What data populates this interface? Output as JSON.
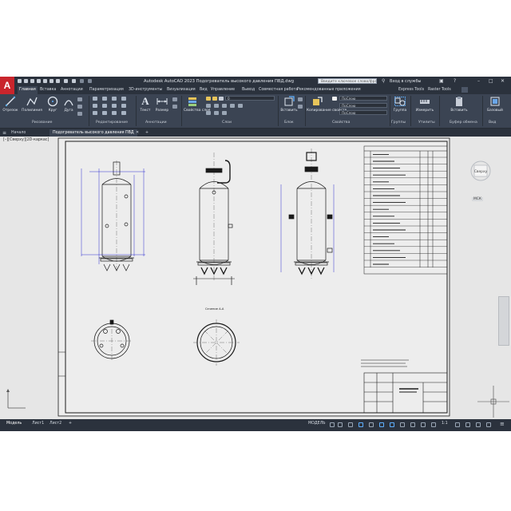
{
  "window": {
    "logo": "A",
    "title": "Autodesk AutoCAD 2023   Подогреватель высокого давления ПВД.dwg",
    "search_placeholder": "Введите ключевое слово/фразу",
    "sign_in": "Вход в службы",
    "controls": [
      "–",
      "□",
      "✕"
    ]
  },
  "menu_tabs": [
    "Главная",
    "Вставка",
    "Аннотации",
    "Параметризация",
    "3D-инструменты",
    "Визуализация",
    "Вид",
    "Управление",
    "Вывод",
    "Совместная работа",
    "Рекомендованные приложения",
    "Express Tools",
    "Raster Tools"
  ],
  "ribbon": {
    "tools": {
      "line": "Отрезок",
      "polyline": "Полилиния",
      "circle": "Круг",
      "arc": "Дуга",
      "text": "Текст",
      "dimension": "Размер",
      "layer_properties": "Свойства слоя",
      "insert": "Вставить",
      "match_properties": "Копирование свойств",
      "group": "Группа",
      "measure": "Измерить",
      "paste": "Вставить",
      "base": "Базовый"
    },
    "combos": {
      "layer_current": "0",
      "color": "ПоСлою",
      "linetype": "ПоСлою",
      "lineweight": "ПоСлою"
    },
    "panels": [
      "Рисование",
      "Редактирование",
      "Аннотации",
      "Слои",
      "Блок",
      "Свойства",
      "Группы",
      "Утилиты",
      "Буфер обмена",
      "Вид"
    ]
  },
  "file_tabs": [
    "Начало",
    "Подогреватель высокого давления ПВД",
    "+"
  ],
  "viewport": {
    "label": "[–][Сверху][2D-каркас]",
    "viewcube_face": "Сверху",
    "viewcube_wcs": "МСК",
    "section_label": "Сечение А-А"
  },
  "status_bar": {
    "layout_tabs": [
      "Модель",
      "Лист1",
      "Лист2",
      "+"
    ],
    "model_label": "МОДЕЛЬ",
    "scale": "1:1"
  },
  "colors": {
    "app_bg": "#3b4453",
    "title_bg": "#2b323d",
    "viewport_bg": "#e6e6e6",
    "accent_red": "#c9252c"
  }
}
